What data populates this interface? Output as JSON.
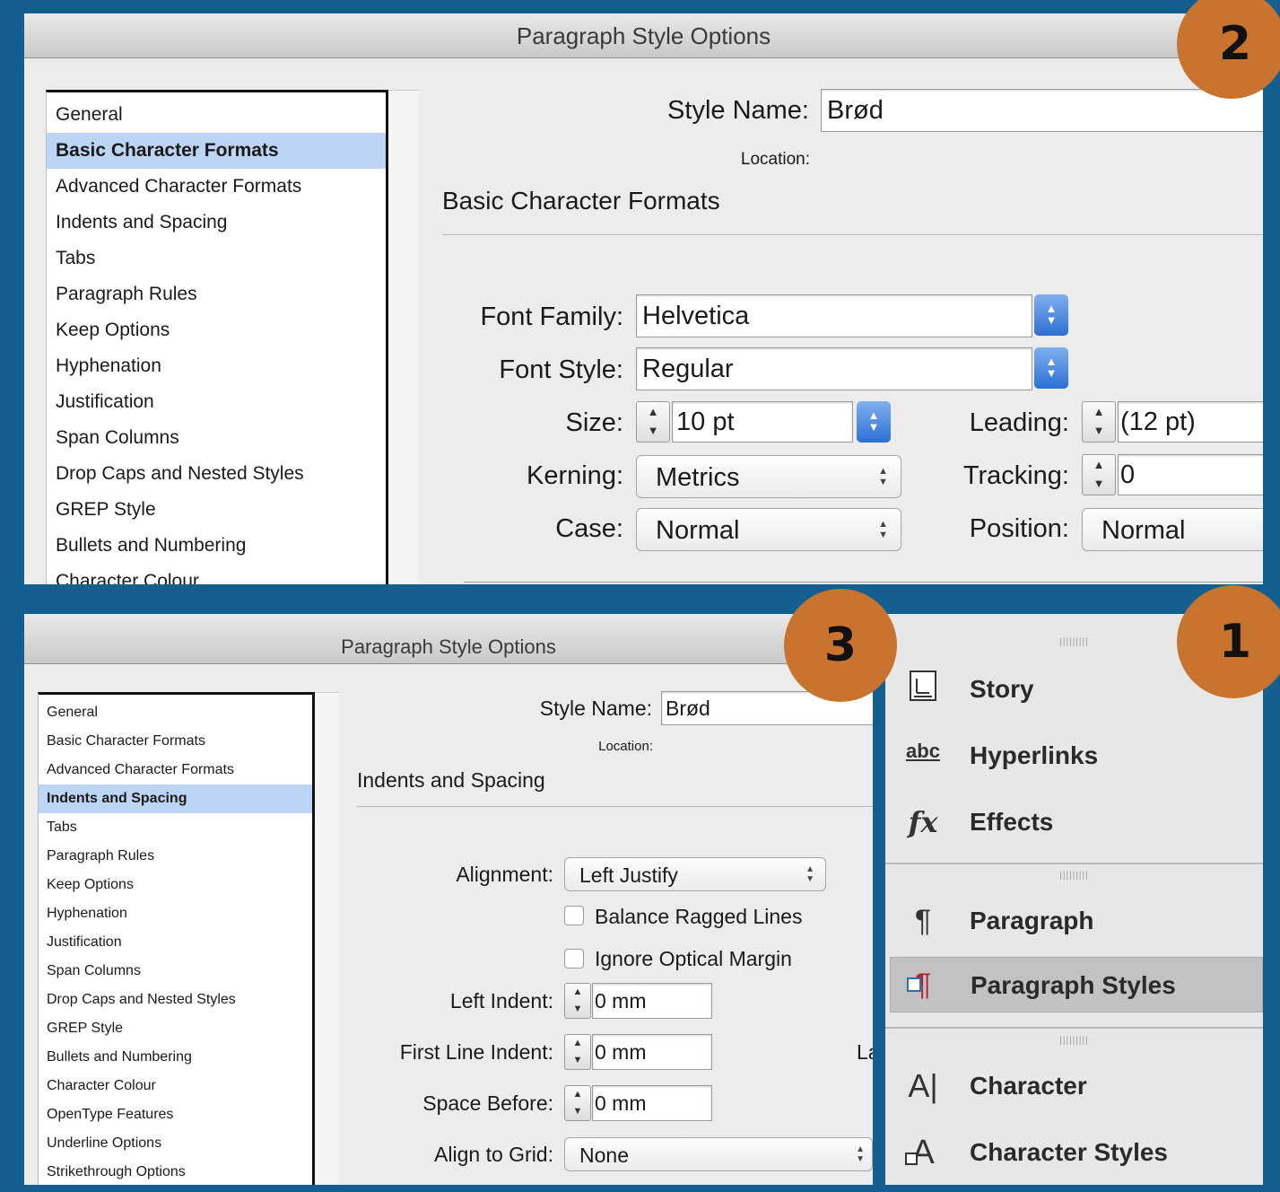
{
  "top_dialog": {
    "title": "Paragraph Style Options",
    "style_name_label": "Style Name:",
    "style_name_value": "Brød",
    "location_label": "Location:",
    "section_title": "Basic Character Formats",
    "categories": [
      "General",
      "Basic Character Formats",
      "Advanced Character Formats",
      "Indents and Spacing",
      "Tabs",
      "Paragraph Rules",
      "Keep Options",
      "Hyphenation",
      "Justification",
      "Span Columns",
      "Drop Caps and Nested Styles",
      "GREP Style",
      "Bullets and Numbering",
      "Character Colour"
    ],
    "selected_category": "Basic Character Formats",
    "font_family_label": "Font Family:",
    "font_family_value": "Helvetica",
    "font_style_label": "Font Style:",
    "font_style_value": "Regular",
    "size_label": "Size:",
    "size_value": "10 pt",
    "leading_label": "Leading:",
    "leading_value": "(12 pt)",
    "kerning_label": "Kerning:",
    "kerning_value": "Metrics",
    "tracking_label": "Tracking:",
    "tracking_value": "0",
    "case_label": "Case:",
    "case_value": "Normal",
    "position_label": "Position:",
    "position_value": "Normal"
  },
  "bottom_dialog": {
    "title": "Paragraph Style Options",
    "style_name_label": "Style Name:",
    "style_name_value": "Brød",
    "location_label": "Location:",
    "section_title": "Indents and Spacing",
    "categories": [
      "General",
      "Basic Character Formats",
      "Advanced Character Formats",
      "Indents and Spacing",
      "Tabs",
      "Paragraph Rules",
      "Keep Options",
      "Hyphenation",
      "Justification",
      "Span Columns",
      "Drop Caps and Nested Styles",
      "GREP Style",
      "Bullets and Numbering",
      "Character Colour",
      "OpenType Features",
      "Underline Options",
      "Strikethrough Options"
    ],
    "selected_category": "Indents and Spacing",
    "alignment_label": "Alignment:",
    "alignment_value": "Left Justify",
    "balance_label": "Balance Ragged Lines",
    "optical_label": "Ignore Optical Margin",
    "left_indent_label": "Left Indent:",
    "left_indent_value": "0 mm",
    "first_line_label": "First Line Indent:",
    "first_line_value": "0 mm",
    "space_before_label": "Space Before:",
    "space_before_value": "0 mm",
    "align_grid_label": "Align to Grid:",
    "align_grid_value": "None",
    "clipped_label": "La"
  },
  "side_panel": {
    "items": [
      {
        "label": "Story",
        "icon": "story-icon"
      },
      {
        "label": "Hyperlinks",
        "icon": "hyperlinks-icon"
      },
      {
        "label": "Effects",
        "icon": "effects-icon"
      },
      {
        "label": "Paragraph",
        "icon": "paragraph-icon"
      },
      {
        "label": "Paragraph Styles",
        "icon": "paragraph-styles-icon"
      },
      {
        "label": "Character",
        "icon": "character-icon"
      },
      {
        "label": "Character Styles",
        "icon": "character-styles-icon"
      }
    ],
    "selected": "Paragraph Styles",
    "grip": "|||||||||"
  },
  "badges": {
    "one": "1",
    "two": "2",
    "three": "3"
  },
  "colors": {
    "frame": "#136090",
    "badge": "#c8742e",
    "selection": "#bcd5f4"
  }
}
